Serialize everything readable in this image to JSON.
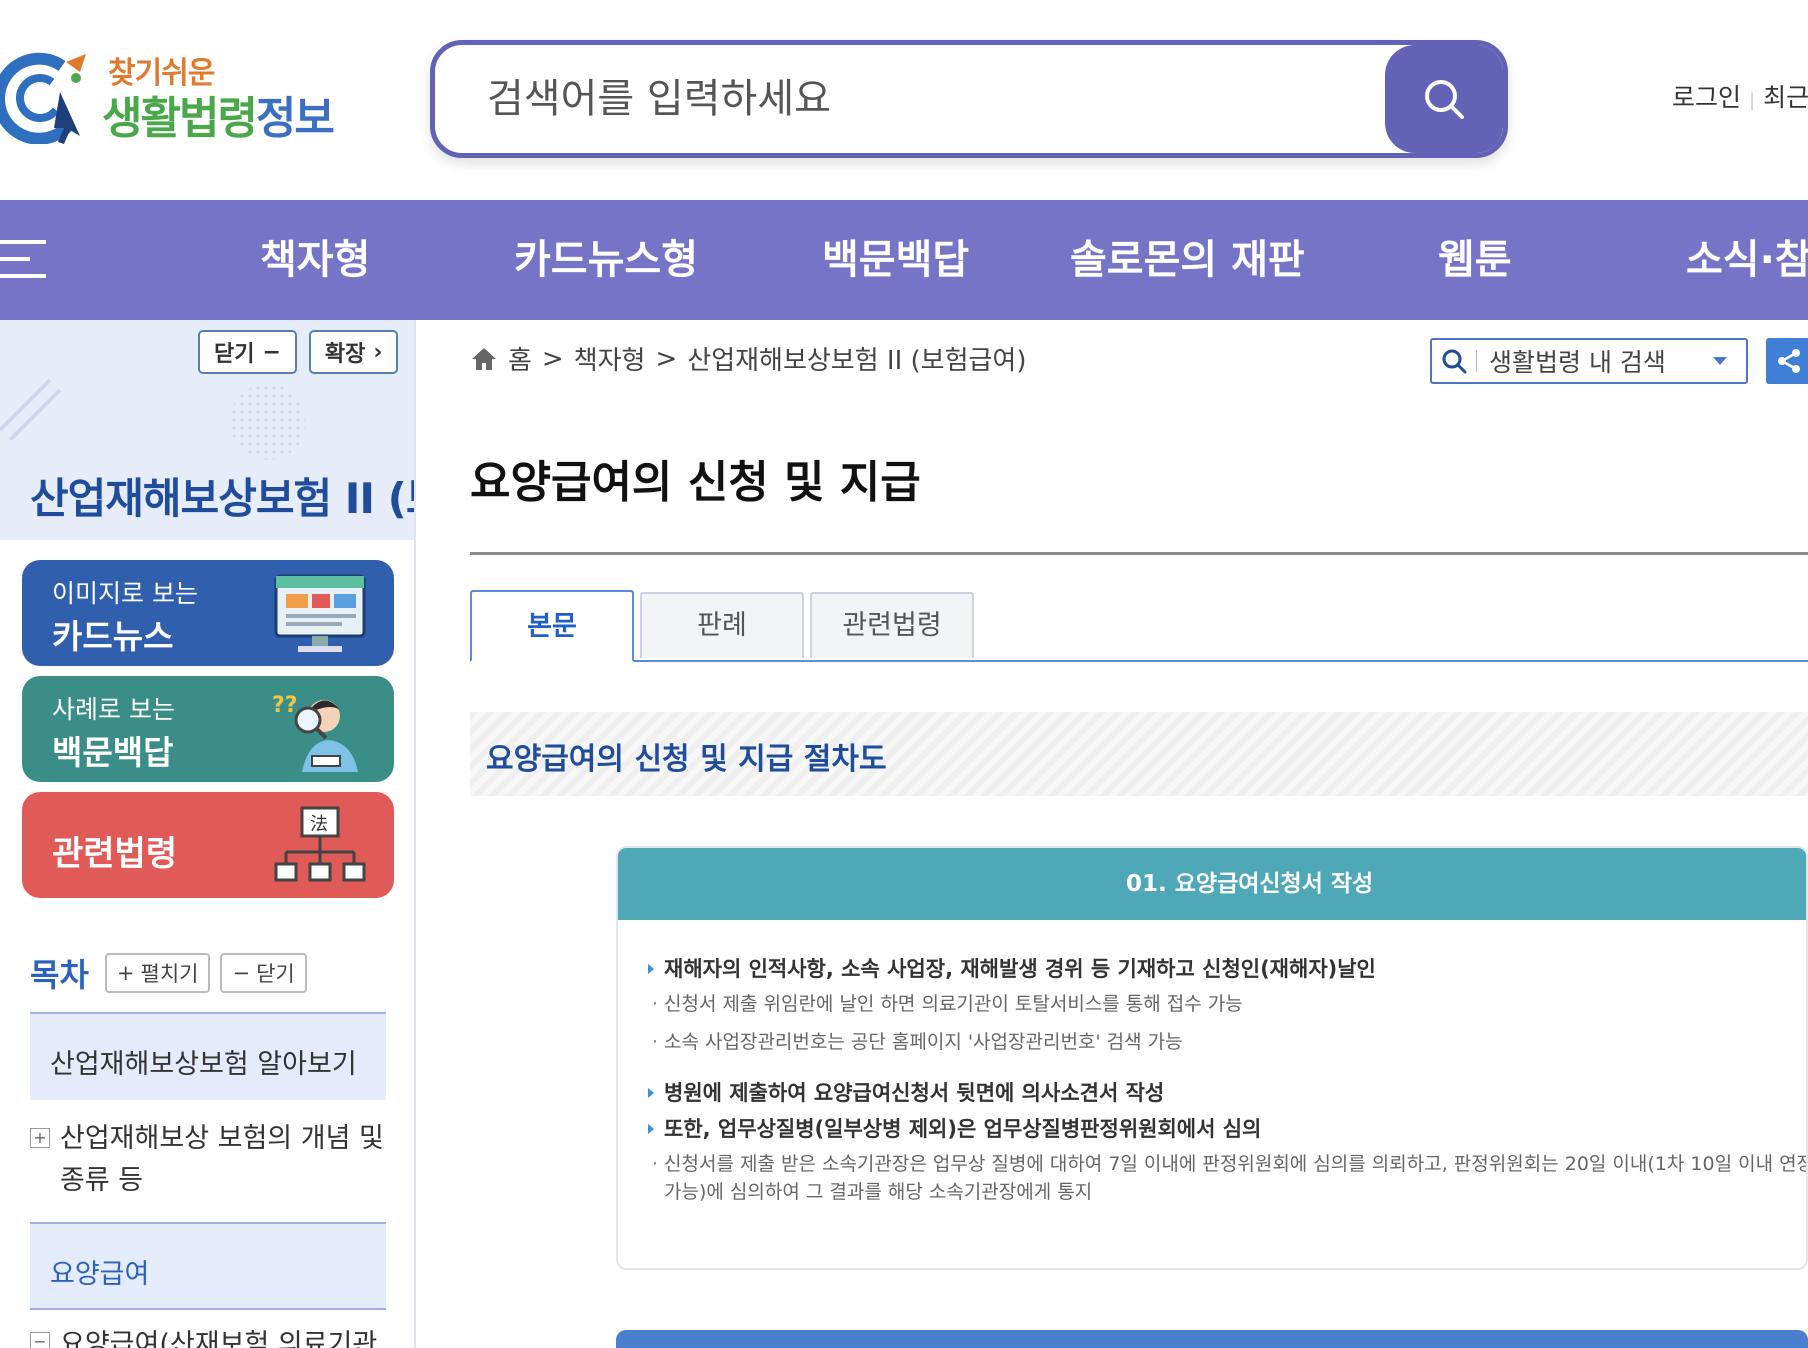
{
  "header": {
    "logo_small": "찾기쉬운",
    "logo_big_part1": "생활법령",
    "logo_big_part2": "정보",
    "search_placeholder": "검색어를 입력하세요",
    "util_login": "로그인",
    "util_recent": "최근"
  },
  "gnb": {
    "items": [
      {
        "label": "책자형"
      },
      {
        "label": "카드뉴스형"
      },
      {
        "label": "백문백답"
      },
      {
        "label": "솔로몬의 재판"
      },
      {
        "label": "웹툰"
      },
      {
        "label": "소식·참"
      }
    ]
  },
  "sidebar": {
    "close_label": "닫기",
    "expand_label": "확장",
    "title": "산업재해보상보험 II (보",
    "quick": {
      "cardnews_small": "이미지로 보는",
      "cardnews_big": "카드뉴스",
      "qna_small": "사례로 보는",
      "qna_big": "백문백답",
      "law": "관련법령"
    },
    "toc": {
      "title": "목차",
      "expand_all": "펼치기",
      "collapse_all": "닫기",
      "items": [
        {
          "label": "산업재해보상보험 알아보기"
        },
        {
          "label": "산업재해보상 보험의 개념 및 종류 등"
        },
        {
          "label": "요양급여"
        },
        {
          "label": "요양급여(산재보험 의료기관"
        }
      ]
    }
  },
  "main": {
    "breadcrumb": [
      "홈",
      ">",
      "책자형",
      ">",
      "산업재해보상보험 II (보험급여)"
    ],
    "local_search_value": "생활법령 내 검색",
    "page_title": "요양급여의 신청 및 지급",
    "tabs": [
      {
        "label": "본문"
      },
      {
        "label": "판례"
      },
      {
        "label": "관련법령"
      }
    ],
    "section_title": "요양급여의 신청 및 지급 절차도",
    "step1": {
      "header": "01. 요양급여신청서 작성",
      "main1": "재해자의 인적사항, 소속 사업장, 재해발생 경위 등 기재하고 신청인(재해자)날인",
      "sub1": "신청서 제출 위임란에 날인 하면 의료기관이 토탈서비스를 통해 접수 가능",
      "sub2": "소속 사업장관리번호는 공단 홈페이지 '사업장관리번호' 검색 가능",
      "main2": "병원에 제출하여 요양급여신청서 뒷면에 의사소견서 작성",
      "main3": "또한, 업무상질병(일부상병 제외)은 업무상질병판정위원회에서 심의",
      "sub3": "신청서를 제출 받은 소속기관장은 업무상 질병에 대하여 7일 이내에 판정위원회에 심의를 의뢰하고, 판정위원회는 20일 이내(1차 10일 이내 연장 가능)에 심의하여 그 결과를 해당 소속기관장에게 통지"
    }
  },
  "colors": {
    "primary": "#6262b7",
    "gnb": "#7574c7",
    "cardnews": "#2f5fad",
    "qna": "#3b8e88",
    "law": "#e05a57",
    "step_header": "#4fa8b8"
  }
}
